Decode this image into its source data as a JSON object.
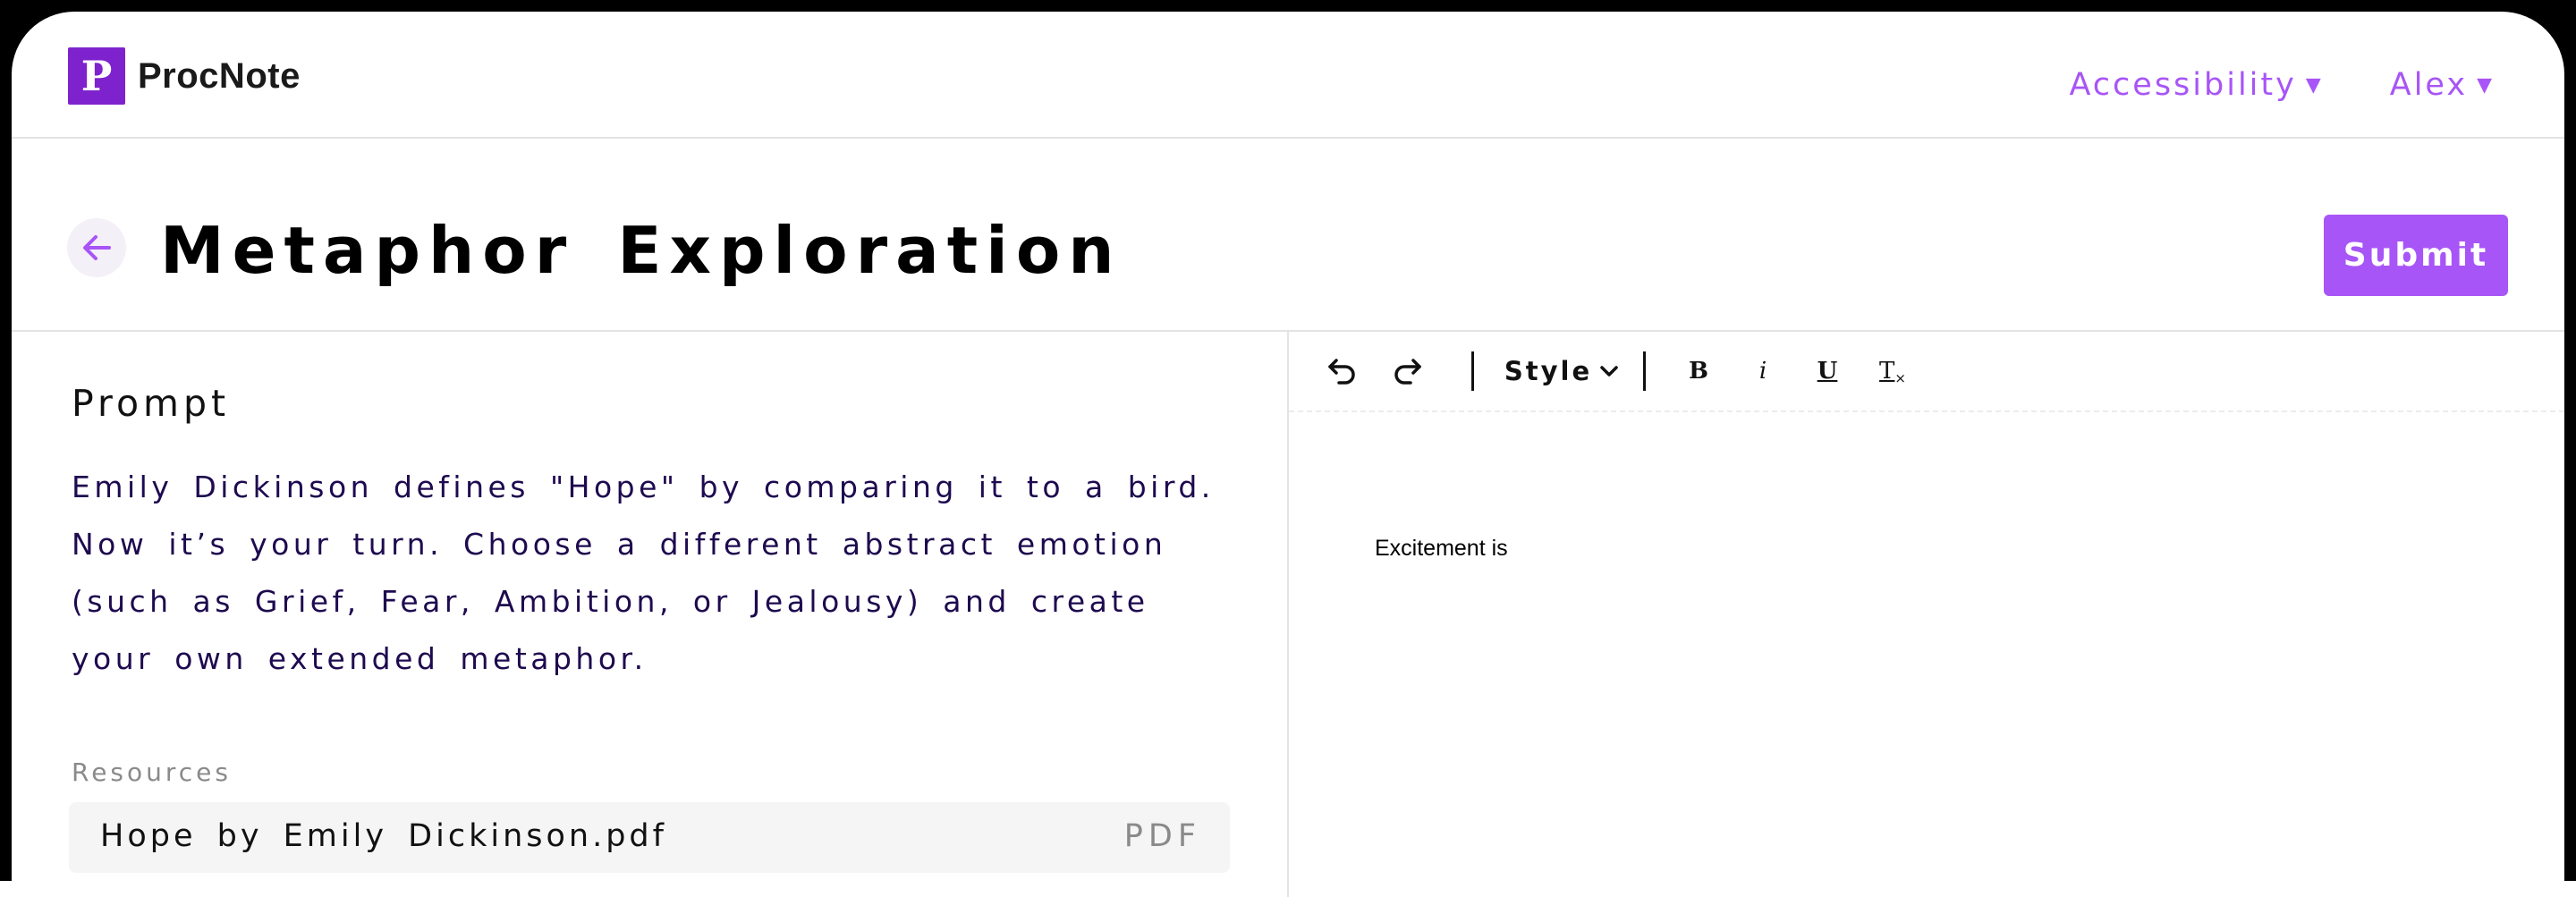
{
  "app": {
    "name": "ProcNote",
    "logo_letter": "P",
    "accent_color": "#a855f7",
    "logo_color": "#7e22ce"
  },
  "nav": {
    "accessibility_label": "Accessibility",
    "user_label": "Alex",
    "caret": "▼"
  },
  "page": {
    "title": "Metaphor Exploration",
    "submit_label": "Submit",
    "back_icon": "arrow-left-icon"
  },
  "prompt": {
    "heading": "Prompt",
    "text": "Emily Dickinson defines \"Hope\" by comparing it to a bird. Now it’s your turn. Choose a different abstract emotion (such as Grief, Fear, Ambition, or Jealousy) and create your own extended metaphor."
  },
  "resources": {
    "label": "Resources",
    "items": [
      {
        "name": "Hope by Emily Dickinson.pdf",
        "type": "PDF"
      }
    ]
  },
  "editor": {
    "toolbar": {
      "undo_icon": "undo-icon",
      "redo_icon": "redo-icon",
      "style_label": "Style",
      "bold_label": "B",
      "italic_label": "i",
      "underline_label": "U",
      "clear_format_label": "T"
    },
    "content": "Excitement is"
  }
}
